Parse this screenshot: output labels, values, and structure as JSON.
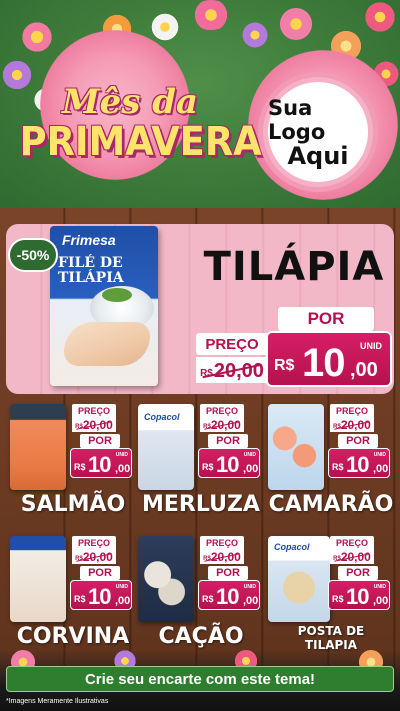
{
  "header": {
    "title_line1": "Mês da",
    "title_line2": "PRIMAVERA",
    "logo_line1": "Sua Logo",
    "logo_line2": "Aqui"
  },
  "featured": {
    "discount": "-50%",
    "brand": "Frimesa",
    "pack_name_line1": "FILÉ DE",
    "pack_name_line2": "TILÁPIA",
    "name": "TILÁPIA",
    "preco_label": "PREÇO",
    "old_currency": "R$",
    "old_price": "20,00",
    "por_label": "POR",
    "currency": "R$",
    "price_int": "10",
    "price_cents": ",00",
    "unit": "UNID"
  },
  "products": [
    {
      "name": "SALMÃO",
      "preco_label": "PREÇO",
      "old_currency": "R$",
      "old_price": "20,00",
      "por_label": "POR",
      "currency": "R$",
      "price_int": "10",
      "price_cents": ",00",
      "unit": "UNID"
    },
    {
      "name": "MERLUZA",
      "brand": "Copacol",
      "preco_label": "PREÇO",
      "old_currency": "R$",
      "old_price": "20,00",
      "por_label": "POR",
      "currency": "R$",
      "price_int": "10",
      "price_cents": ",00",
      "unit": "UNID"
    },
    {
      "name": "CAMARÃO",
      "preco_label": "PREÇO",
      "old_currency": "R$",
      "old_price": "20,00",
      "por_label": "POR",
      "currency": "R$",
      "price_int": "10",
      "price_cents": ",00",
      "unit": "UNID"
    },
    {
      "name": "CORVINA",
      "preco_label": "PREÇO",
      "old_currency": "R$",
      "old_price": "20,00",
      "por_label": "POR",
      "currency": "R$",
      "price_int": "10",
      "price_cents": ",00",
      "unit": "UNID"
    },
    {
      "name": "CAÇÃO",
      "preco_label": "PREÇO",
      "old_currency": "R$",
      "old_price": "20,00",
      "por_label": "POR",
      "currency": "R$",
      "price_int": "10",
      "price_cents": ",00",
      "unit": "UNID"
    },
    {
      "name_line1": "POSTA DE",
      "name_line2": "TILAPIA",
      "brand": "Copacol",
      "preco_label": "PREÇO",
      "old_currency": "R$",
      "old_price": "20,00",
      "por_label": "POR",
      "currency": "R$",
      "price_int": "10",
      "price_cents": ",00",
      "unit": "UNID"
    }
  ],
  "cta": "Crie seu encarte com este tema!",
  "footer_note": "*Imagens Meramente Ilustrativas",
  "colors": {
    "header_green": "#3d7a3a",
    "title_yellow": "#ffe46b",
    "price_magenta": "#c0175a",
    "feature_pink": "#f2b8c8",
    "wood": "#6c3b22",
    "cta_green": "#2f7d2f"
  }
}
